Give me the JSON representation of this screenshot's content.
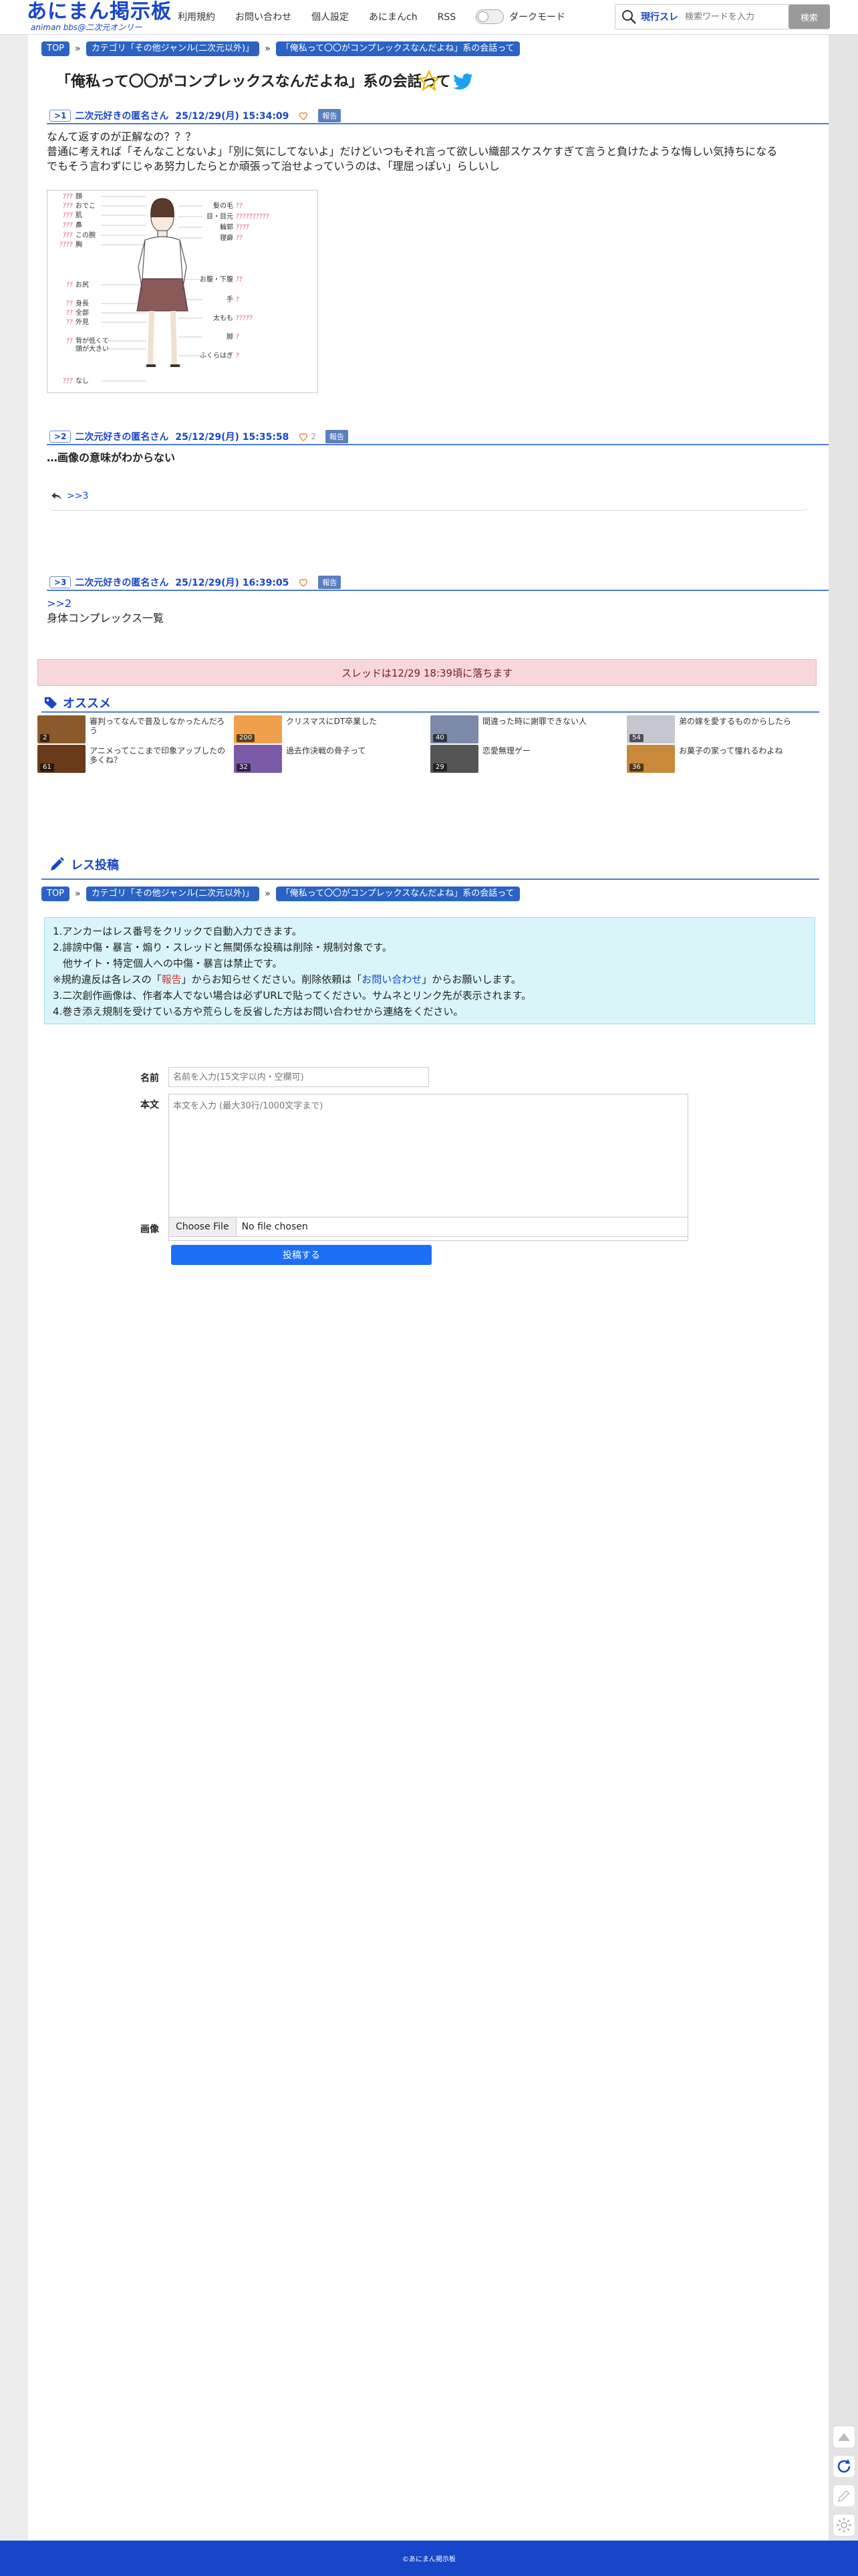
{
  "header": {
    "logo_main": "あにまん掲示板",
    "logo_sub": "animan bbs@二次元オンリー",
    "nav": [
      "利用規約",
      "お問い合わせ",
      "個人設定",
      "あにまんch",
      "RSS"
    ],
    "darkmode_label": "ダークモード",
    "search_scope": "現行スレ",
    "search_placeholder": "検索ワードを入力",
    "search_button": "検索"
  },
  "breadcrumb": {
    "items": [
      "TOP",
      "カテゴリ「その他ジャンル(二次元以外)」",
      "「俺私って〇〇がコンプレックスなんだよね」系の会話って"
    ],
    "sep": "»"
  },
  "thread_title": "「俺私って〇〇がコンプレックスなんだよね」系の会話って",
  "posts": [
    {
      "num": ">1",
      "name": "二次元好きの匿名さん",
      "date": "25/12/29(月) 15:34:09",
      "likes": "",
      "report": "報告",
      "lines": [
        "なんて返すのが正解なの？？？",
        "普通に考えれば「そんなことないよ」「別に気にしてないよ」だけどいつもそれ言って欲しい織部スケスケすぎて言うと負けたような悔しい気持ちになる",
        "でもそう言わずにじゃあ努力したらとか頑張って治せよっていうのは、「理屈っぽい」らしいし"
      ]
    },
    {
      "num": ">2",
      "name": "二次元好きの匿名さん",
      "date": "25/12/29(月) 15:35:58",
      "likes": "2",
      "report": "報告",
      "lines": [
        "…画像の意味がわからない"
      ],
      "reply": ">>3"
    },
    {
      "num": ">3",
      "name": "二次元好きの匿名さん",
      "date": "25/12/29(月) 16:39:05",
      "likes": "",
      "report": "報告",
      "anchor": ">>2",
      "lines": [
        "身体コンプレックス一覧"
      ]
    }
  ],
  "diagram": {
    "left": [
      {
        "heart": "ｱｱｱ",
        "t": "顔"
      },
      {
        "heart": "ｱｱｱ",
        "t": "おでこ"
      },
      {
        "heart": "ｱｱｱ",
        "t": "肌"
      },
      {
        "heart": "ｱｱｱ",
        "t": "鼻"
      },
      {
        "heart": "ｱｱｱ",
        "t": "この腕"
      },
      {
        "heart": "ｱｱｱｱ",
        "t": "胸"
      },
      {
        "heart": "ｱｱ",
        "t": "お尻"
      },
      {
        "heart": "ｱｱ",
        "t": "身長"
      },
      {
        "heart": "ｱｱ",
        "t": "全部"
      },
      {
        "heart": "ｱｱ",
        "t": "外見"
      },
      {
        "heart": "ｱｱ",
        "t": "背が低くて"
      },
      {
        "heart": "",
        "t": "頭が大きい"
      },
      {
        "heart": "ｱｱｱ",
        "t": "なし"
      }
    ],
    "right": [
      {
        "t": "髪の毛",
        "heart": "ｱｱ"
      },
      {
        "t": "目・目元",
        "heart": "ｱｱｱｱｱｱｱｱｱｱ"
      },
      {
        "t": "輪郭",
        "heart": "ｱｱｱｱ"
      },
      {
        "t": "寝癖",
        "heart": "ｱｱ"
      },
      {
        "t": "お腹・下腹",
        "heart": "ｱｱ"
      },
      {
        "t": "手",
        "heart": "ｱ"
      },
      {
        "t": "太もも",
        "heart": "ｱｱｱｱｱ"
      },
      {
        "t": "脚",
        "heart": "ｱ"
      },
      {
        "t": "ふくらはぎ",
        "heart": "ｱ"
      }
    ]
  },
  "fallen_notice": "スレッドは12/29 18:39頃に落ちます",
  "recommend": {
    "heading": "オススメ",
    "items": [
      {
        "title": "審判ってなんで普及しなかったんだろう",
        "count": "2",
        "color": "#8a5a2a"
      },
      {
        "title": "クリスマスにDT卒業した",
        "count": "200",
        "color": "#f0a04a"
      },
      {
        "title": "間違った時に謝罪できない人",
        "count": "40",
        "color": "#7a8aa8"
      },
      {
        "title": "弟の嫁を愛するものからしたら",
        "count": "54",
        "color": "#c6c6d0"
      },
      {
        "title": "アニメってここまで印象アップしたの多くね？",
        "count": "61",
        "color": "#6a3a1a"
      },
      {
        "title": "過去作決戦の骨子って",
        "count": "32",
        "color": "#7a5aa8"
      },
      {
        "title": "恋愛無理ゲー",
        "count": "29",
        "color": "#555"
      },
      {
        "title": "お菓子の家って憧れるわよね",
        "count": "36",
        "color": "#c88a3a"
      }
    ]
  },
  "reply_form": {
    "heading": "レス投稿",
    "notes": [
      {
        "text": "1.アンカーはレス番号をクリックで自動入力できます。"
      },
      {
        "text": "2.誹謗中傷・暴言・煽り・スレッドと無関係な投稿は削除・規制対象です。"
      },
      {
        "text": "　他サイト・特定個人への中傷・暴言は禁止です。"
      },
      {
        "text_a": "※規約違反は各レスの「",
        "text_b": "報告",
        "text_c": "」からお知らせください。削除依頼は「",
        "text_d": "お問い合わせ",
        "text_e": "」からお願いします。"
      },
      {
        "text_red": "3.二次創作画像は、作者本人でない場合は必ずURLで貼ってください。サムネとリンク先が表示されます。"
      },
      {
        "text": "4.巻き添え規制を受けている方や荒らしを反省した方はお問い合わせから連絡をください。"
      }
    ],
    "name_label": "名前",
    "name_placeholder": "名前を入力(15文字以内・空欄可)",
    "body_label": "本文",
    "body_placeholder": "本文を入力 (最大30行/1000文字まで)",
    "image_label": "画像",
    "file_button": "Choose File",
    "file_status": "No file chosen",
    "submit": "投稿する"
  },
  "footer": "©あにまん掲示板"
}
